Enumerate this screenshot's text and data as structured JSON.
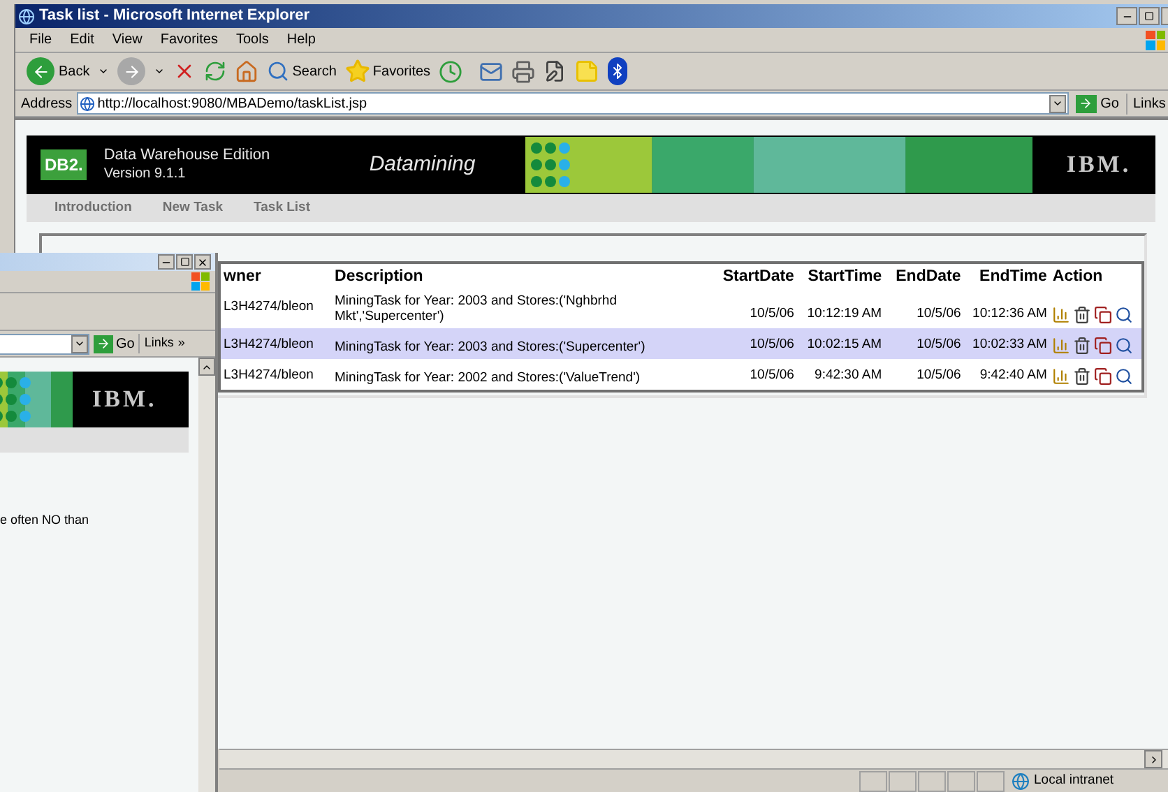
{
  "window": {
    "title": "Task list - Microsoft Internet Explorer"
  },
  "menu": [
    "File",
    "Edit",
    "View",
    "Favorites",
    "Tools",
    "Help"
  ],
  "toolbar": {
    "back": "Back",
    "search": "Search",
    "favorites": "Favorites"
  },
  "address": {
    "label": "Address",
    "value": "http://localhost:9080/MBADemo/taskList.jsp",
    "go": "Go",
    "links": "Links"
  },
  "banner": {
    "badge": "DB2.",
    "product": "Data Warehouse Edition",
    "version": "Version 9.1.1",
    "module": "Datamining",
    "logo": "IBM."
  },
  "nav": [
    "Introduction",
    "New Task",
    "Task List"
  ],
  "table": {
    "columns": [
      "wner",
      "Description",
      "StartDate",
      "StartTime",
      "EndDate",
      "EndTime",
      "Action"
    ],
    "rows": [
      {
        "selected": false,
        "cells": [
          "L3H4274/bleon",
          "MiningTask for Year: 2003 and Stores:('Nghbrhd Mkt','Supercenter')",
          "10/5/06",
          "10:12:19 AM",
          "10/5/06",
          "10:12:36 AM"
        ]
      },
      {
        "selected": true,
        "cells": [
          "L3H4274/bleon",
          "MiningTask for Year: 2003 and Stores:('Supercenter')",
          "10/5/06",
          "10:02:15 AM",
          "10/5/06",
          "10:02:33 AM"
        ]
      },
      {
        "selected": false,
        "cells": [
          "L3H4274/bleon",
          "MiningTask for Year: 2002 and Stores:('ValueTrend')",
          "10/5/06",
          "9:42:30 AM",
          "10/5/06",
          "9:42:40 AM"
        ]
      }
    ]
  },
  "status_bar": {
    "zone": "Local intranet"
  },
  "second_window": {
    "go": "Go",
    "links": "Links",
    "chevron": "»",
    "logo": "IBM.",
    "text": "e often NO than"
  }
}
